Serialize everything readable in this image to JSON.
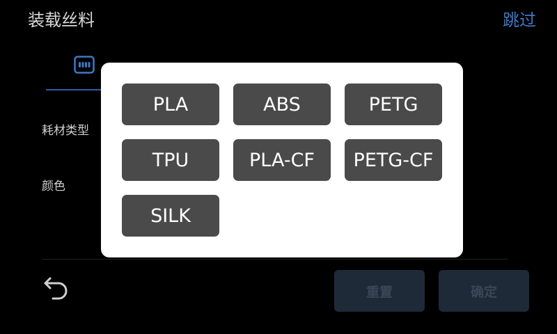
{
  "header": {
    "title": "装载丝料",
    "skip_label": "跳过"
  },
  "form": {
    "type_label": "耗材类型",
    "color_label": "颜色"
  },
  "footer": {
    "reset_label": "重置",
    "confirm_label": "确定"
  },
  "popup": {
    "materials": [
      "PLA",
      "ABS",
      "PETG",
      "TPU",
      "PLA-CF",
      "PETG-CF",
      "SILK"
    ]
  },
  "colors": {
    "background": "#000000",
    "accent": "#3f78c8",
    "popup_bg": "#ffffff",
    "material_button": "#4a4a4a",
    "disabled_button": "#1f2a38"
  },
  "icons": {
    "spool": "spool-icon",
    "back": "back-arrow-icon"
  }
}
